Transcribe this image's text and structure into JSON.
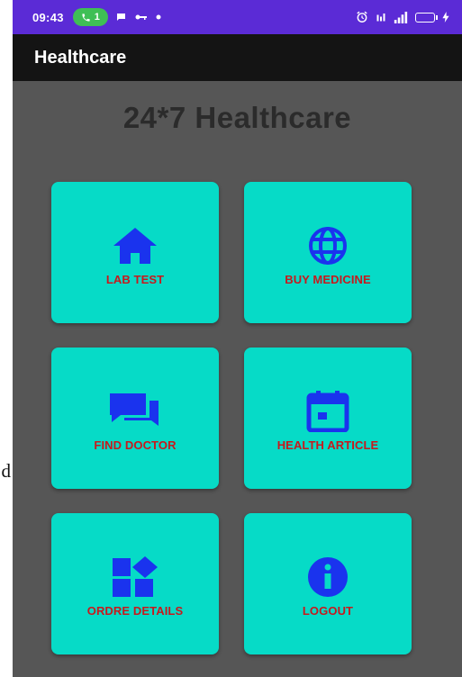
{
  "edge_text": "d",
  "status_bar": {
    "time": "09:43",
    "pill_text": "1",
    "colors": {
      "background": "#5b2bd6",
      "pill": "#3fbf55"
    }
  },
  "app_bar": {
    "title": "Healthcare"
  },
  "main": {
    "heading": "24*7 Healthcare",
    "tiles": [
      {
        "label": "LAB TEST",
        "icon": "home-icon"
      },
      {
        "label": "BUY MEDICINE",
        "icon": "globe-icon"
      },
      {
        "label": "FIND DOCTOR",
        "icon": "chat-icon"
      },
      {
        "label": "HEALTH ARTICLE",
        "icon": "calendar-icon"
      },
      {
        "label": "ORDRE DETAILS",
        "icon": "dashboard-icon"
      },
      {
        "label": "LOGOUT",
        "icon": "info-icon"
      }
    ]
  },
  "colors": {
    "tile_background": "#06dbc7",
    "tile_label": "#c7191d",
    "icon": "#1a33ee",
    "page_background": "#565656",
    "app_bar": "#141414"
  }
}
